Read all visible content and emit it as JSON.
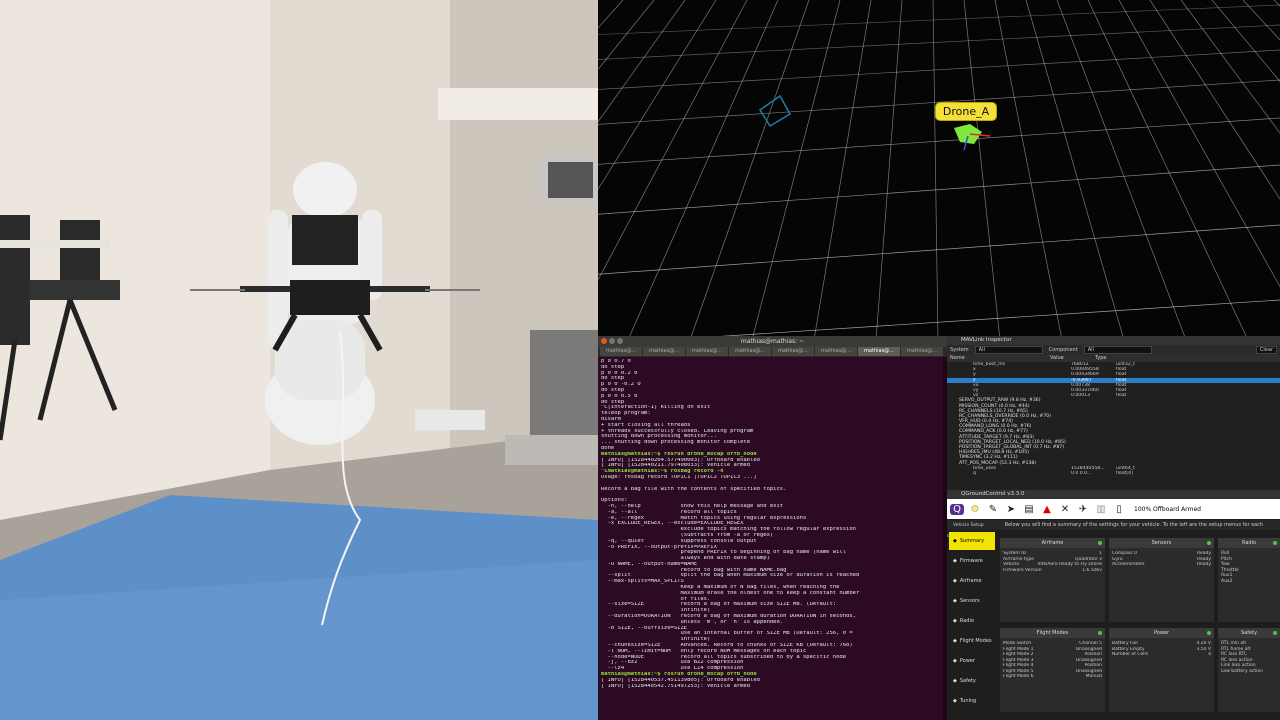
{
  "view3d": {
    "drone_label": "Drone_A"
  },
  "terminal": {
    "title": "mathias@mathias: ~",
    "tabs": [
      "mathias@...",
      "mathias@...",
      "mathias@...",
      "mathias@...",
      "mathias@...",
      "mathias@...",
      "mathias@...",
      "mathias@..."
    ],
    "lines": [
      "p 0 0.7 0",
      "do step",
      "p 0 0 0.2 0",
      "do step",
      "p 0 0 -0.2 0",
      "do step",
      "p 0 0 0.5 0",
      "do step",
      "^C[interaction-1] killing on exit",
      "teleop program:",
      "disarm",
      "+ start closing all threads",
      "+ threads successfully closed. Leaving program",
      "shutting down processing monitor...",
      "... shutting down processing monitor complete",
      "done",
      "mathias@mathias:~$ rosrun drone_mocap offb_node",
      "[ INFO] [1528440204.577490003]: Offboard enabled",
      "[ INFO] [1528440211.797408033]: Vehicle armed",
      "^Cmathias@mathias:~$ rosbag record -h",
      "Usage: rosbag record TOPIC1 [TOPIC2 TOPIC3 ...]",
      "",
      "Record a bag file with the contents of specified topics.",
      "",
      "Options:",
      "  -h, --help            show this help message and exit",
      "  -a, --all             record all topics",
      "  -e, --regex           match topics using regular expressions",
      "  -x EXCLUDE_REGEX, --exclude=EXCLUDE_REGEX",
      "                        exclude topics matching the follow regular expression",
      "                        (subtracts from -a or regex)",
      "  -q, --quiet           suppress console output",
      "  -o PREFIX, --output-prefix=PREFIX",
      "                        prepend PREFIX to beginning of bag name (name will",
      "                        always end with date stamp)",
      "  -O NAME, --output-name=NAME",
      "                        record to bag with name NAME.bag",
      "  --split               split the bag when maximum size or duration is reached",
      "  --max-splits=MAX_SPLITS",
      "                        Keep a maximum of N bag files, when reaching the",
      "                        maximum erase the oldest one to keep a constant number",
      "                        of files.",
      "  --size=SIZE           record a bag of maximum size SIZE MB. (Default:",
      "                        infinite)",
      "  --duration=DURATION   record a bag of maximum duration DURATION in seconds,",
      "                        unless 'm', or 'h' is appended.",
      "  -b SIZE, --buffsize=SIZE",
      "                        use an internal buffer of SIZE MB (Default: 256, 0 =",
      "                        infinite)",
      "  --chunksize=SIZE      Advanced. Record to chunks of SIZE KB (Default: 768)",
      "  -l NUM, --limit=NUM   only record NUM messages on each topic",
      "  --node=NODE           record all topics subscribed to by a specific node",
      "  -j, --bz2             use BZ2 compression",
      "  --lz4                 use LZ4 compression",
      "mathias@mathias:~$ rosrun drone_mocap offb_node",
      "[ INFO] [1528440537.451139805]: Offboard enabled",
      "[ INFO] [1528440542.751497253]: Vehicle armed"
    ]
  },
  "inspector": {
    "title": "MAVLink Inspector",
    "system_label": "System",
    "system_value": "All",
    "component_label": "Component",
    "component_value": "All",
    "clear_label": "Clear",
    "col_name": "Name",
    "col_value": "Value",
    "col_type": "Type",
    "fields": [
      {
        "name": "time_boot_ms",
        "value": "768012",
        "type": "uint32_t"
      },
      {
        "name": "x",
        "value": "0.00049558",
        "type": "float"
      },
      {
        "name": "y",
        "value": "0.00434669",
        "type": "float"
      },
      {
        "name": "z",
        "value": "-0.93997",
        "type": "float"
      },
      {
        "name": "vx",
        "value": "0.00738",
        "type": "float"
      },
      {
        "name": "vy",
        "value": "0.00337060",
        "type": "float"
      },
      {
        "name": "vz",
        "value": "0.00013",
        "type": "float"
      }
    ],
    "messages": [
      "SERVO_OUTPUT_RAW (9.8 Hz, #36)",
      "MISSION_COUNT (0.0 Hz, #44)",
      "RC_CHANNELS (10.7 Hz, #65)",
      "RC_CHANNELS_OVERRIDE (0.0 Hz, #70)",
      "VFR_HUD (0.4 Hz, #74)",
      "COMMAND_LONG (0.0 Hz, #76)",
      "COMMAND_ACK (0.0 Hz, #77)",
      "ATTITUDE_TARGET (9.7 Hz, #83)",
      "POSITION_TARGET_LOCAL_NED (10.0 Hz, #85)",
      "POSITION_TARGET_GLOBAL_INT (0.7 Hz, #87)",
      "HIGHRES_IMU (48.8 Hz, #105)",
      "TIMESYNC (3.2 Hz, #111)",
      "ATT_POS_MOCAP (52.3 Hz, #138)"
    ],
    "bottom_rows": [
      {
        "name": "time_usec",
        "value": "1528440558...",
        "type": "uint64_t"
      },
      {
        "name": "q",
        "value": "0.0 0.0...",
        "type": "float[4]"
      }
    ]
  },
  "qgc": {
    "title": "QGroundControl v3.3.0",
    "status": "100%  Offboard  Armed",
    "summary_text": "Below you will find a summary of the settings for your vehicle. To the left are the setup menus for each component.",
    "vehicle_setup": "Vehicle Setup",
    "sidebar": [
      "Summary",
      "Firmware",
      "Airframe",
      "Sensors",
      "Radio",
      "Flight Modes",
      "Power",
      "Safety",
      "Tuning"
    ],
    "cards": {
      "airframe": {
        "title": "Airframe",
        "rows": [
          [
            "System ID",
            "1"
          ],
          [
            "Airframe type",
            "Quadrotor x"
          ],
          [
            "Vehicle",
            "IntelAero Ready to Fly Drone"
          ],
          [
            "Firmware Version",
            "1.6.5dev"
          ]
        ]
      },
      "sensors": {
        "title": "Sensors",
        "rows": [
          [
            "Compass 0",
            "Ready"
          ],
          [
            "Gyro",
            "Ready"
          ],
          [
            "Accelerometer",
            "Ready"
          ]
        ]
      },
      "radio": {
        "title": "Radio",
        "rows": [
          "Roll",
          "Pitch",
          "Yaw",
          "Throttle",
          "Aux1",
          "Aux2"
        ]
      },
      "flight_modes": {
        "title": "Flight Modes",
        "rows": [
          [
            "Mode switch",
            "Channel 5"
          ],
          [
            "Flight Mode 1",
            "Unassigned"
          ],
          [
            "Flight Mode 2",
            "Position"
          ],
          [
            "Flight Mode 3",
            "Unassigned"
          ],
          [
            "Flight Mode 4",
            "Position"
          ],
          [
            "Flight Mode 5",
            "Unassigned"
          ],
          [
            "Flight Mode 6",
            "Manual"
          ]
        ]
      },
      "power": {
        "title": "Power",
        "rows": [
          [
            "Battery Full",
            "4.20 V"
          ],
          [
            "Battery Empty",
            "3.50 V"
          ],
          [
            "Number of Cells",
            "4"
          ]
        ]
      },
      "safety": {
        "title": "Safety",
        "rows": [
          "RTL min alt",
          "RTL home alt",
          "RC loss RTL",
          "RC loss action",
          "Link loss action",
          "Low battery action"
        ]
      }
    }
  },
  "colors": {
    "terminal_bg": "#2c0a24",
    "qgc_accent": "#f2e300",
    "selection": "#2d7fc5",
    "drone_label": "#f4e03a"
  }
}
